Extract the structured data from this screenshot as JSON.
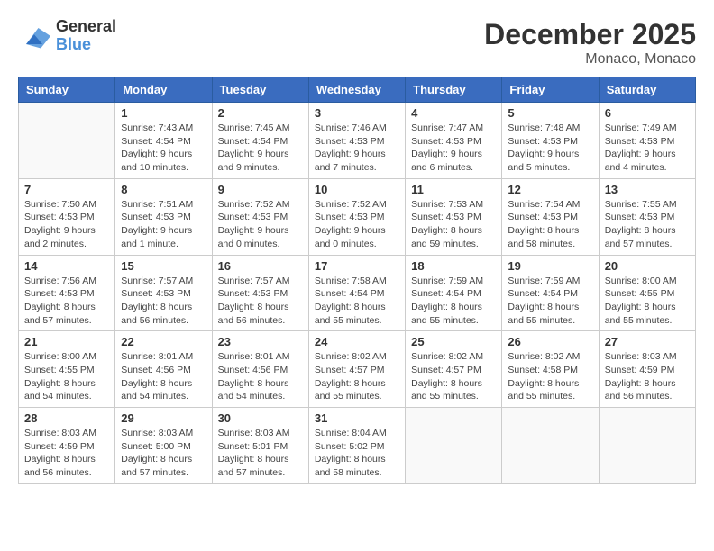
{
  "header": {
    "logo_line1": "General",
    "logo_line2": "Blue",
    "title": "December 2025",
    "subtitle": "Monaco, Monaco"
  },
  "days_of_week": [
    "Sunday",
    "Monday",
    "Tuesday",
    "Wednesday",
    "Thursday",
    "Friday",
    "Saturday"
  ],
  "weeks": [
    [
      {
        "day": "",
        "info": ""
      },
      {
        "day": "1",
        "info": "Sunrise: 7:43 AM\nSunset: 4:54 PM\nDaylight: 9 hours\nand 10 minutes."
      },
      {
        "day": "2",
        "info": "Sunrise: 7:45 AM\nSunset: 4:54 PM\nDaylight: 9 hours\nand 9 minutes."
      },
      {
        "day": "3",
        "info": "Sunrise: 7:46 AM\nSunset: 4:53 PM\nDaylight: 9 hours\nand 7 minutes."
      },
      {
        "day": "4",
        "info": "Sunrise: 7:47 AM\nSunset: 4:53 PM\nDaylight: 9 hours\nand 6 minutes."
      },
      {
        "day": "5",
        "info": "Sunrise: 7:48 AM\nSunset: 4:53 PM\nDaylight: 9 hours\nand 5 minutes."
      },
      {
        "day": "6",
        "info": "Sunrise: 7:49 AM\nSunset: 4:53 PM\nDaylight: 9 hours\nand 4 minutes."
      }
    ],
    [
      {
        "day": "7",
        "info": "Sunrise: 7:50 AM\nSunset: 4:53 PM\nDaylight: 9 hours\nand 2 minutes."
      },
      {
        "day": "8",
        "info": "Sunrise: 7:51 AM\nSunset: 4:53 PM\nDaylight: 9 hours\nand 1 minute."
      },
      {
        "day": "9",
        "info": "Sunrise: 7:52 AM\nSunset: 4:53 PM\nDaylight: 9 hours\nand 0 minutes."
      },
      {
        "day": "10",
        "info": "Sunrise: 7:52 AM\nSunset: 4:53 PM\nDaylight: 9 hours\nand 0 minutes."
      },
      {
        "day": "11",
        "info": "Sunrise: 7:53 AM\nSunset: 4:53 PM\nDaylight: 8 hours\nand 59 minutes."
      },
      {
        "day": "12",
        "info": "Sunrise: 7:54 AM\nSunset: 4:53 PM\nDaylight: 8 hours\nand 58 minutes."
      },
      {
        "day": "13",
        "info": "Sunrise: 7:55 AM\nSunset: 4:53 PM\nDaylight: 8 hours\nand 57 minutes."
      }
    ],
    [
      {
        "day": "14",
        "info": "Sunrise: 7:56 AM\nSunset: 4:53 PM\nDaylight: 8 hours\nand 57 minutes."
      },
      {
        "day": "15",
        "info": "Sunrise: 7:57 AM\nSunset: 4:53 PM\nDaylight: 8 hours\nand 56 minutes."
      },
      {
        "day": "16",
        "info": "Sunrise: 7:57 AM\nSunset: 4:53 PM\nDaylight: 8 hours\nand 56 minutes."
      },
      {
        "day": "17",
        "info": "Sunrise: 7:58 AM\nSunset: 4:54 PM\nDaylight: 8 hours\nand 55 minutes."
      },
      {
        "day": "18",
        "info": "Sunrise: 7:59 AM\nSunset: 4:54 PM\nDaylight: 8 hours\nand 55 minutes."
      },
      {
        "day": "19",
        "info": "Sunrise: 7:59 AM\nSunset: 4:54 PM\nDaylight: 8 hours\nand 55 minutes."
      },
      {
        "day": "20",
        "info": "Sunrise: 8:00 AM\nSunset: 4:55 PM\nDaylight: 8 hours\nand 55 minutes."
      }
    ],
    [
      {
        "day": "21",
        "info": "Sunrise: 8:00 AM\nSunset: 4:55 PM\nDaylight: 8 hours\nand 54 minutes."
      },
      {
        "day": "22",
        "info": "Sunrise: 8:01 AM\nSunset: 4:56 PM\nDaylight: 8 hours\nand 54 minutes."
      },
      {
        "day": "23",
        "info": "Sunrise: 8:01 AM\nSunset: 4:56 PM\nDaylight: 8 hours\nand 54 minutes."
      },
      {
        "day": "24",
        "info": "Sunrise: 8:02 AM\nSunset: 4:57 PM\nDaylight: 8 hours\nand 55 minutes."
      },
      {
        "day": "25",
        "info": "Sunrise: 8:02 AM\nSunset: 4:57 PM\nDaylight: 8 hours\nand 55 minutes."
      },
      {
        "day": "26",
        "info": "Sunrise: 8:02 AM\nSunset: 4:58 PM\nDaylight: 8 hours\nand 55 minutes."
      },
      {
        "day": "27",
        "info": "Sunrise: 8:03 AM\nSunset: 4:59 PM\nDaylight: 8 hours\nand 56 minutes."
      }
    ],
    [
      {
        "day": "28",
        "info": "Sunrise: 8:03 AM\nSunset: 4:59 PM\nDaylight: 8 hours\nand 56 minutes."
      },
      {
        "day": "29",
        "info": "Sunrise: 8:03 AM\nSunset: 5:00 PM\nDaylight: 8 hours\nand 57 minutes."
      },
      {
        "day": "30",
        "info": "Sunrise: 8:03 AM\nSunset: 5:01 PM\nDaylight: 8 hours\nand 57 minutes."
      },
      {
        "day": "31",
        "info": "Sunrise: 8:04 AM\nSunset: 5:02 PM\nDaylight: 8 hours\nand 58 minutes."
      },
      {
        "day": "",
        "info": ""
      },
      {
        "day": "",
        "info": ""
      },
      {
        "day": "",
        "info": ""
      }
    ]
  ]
}
